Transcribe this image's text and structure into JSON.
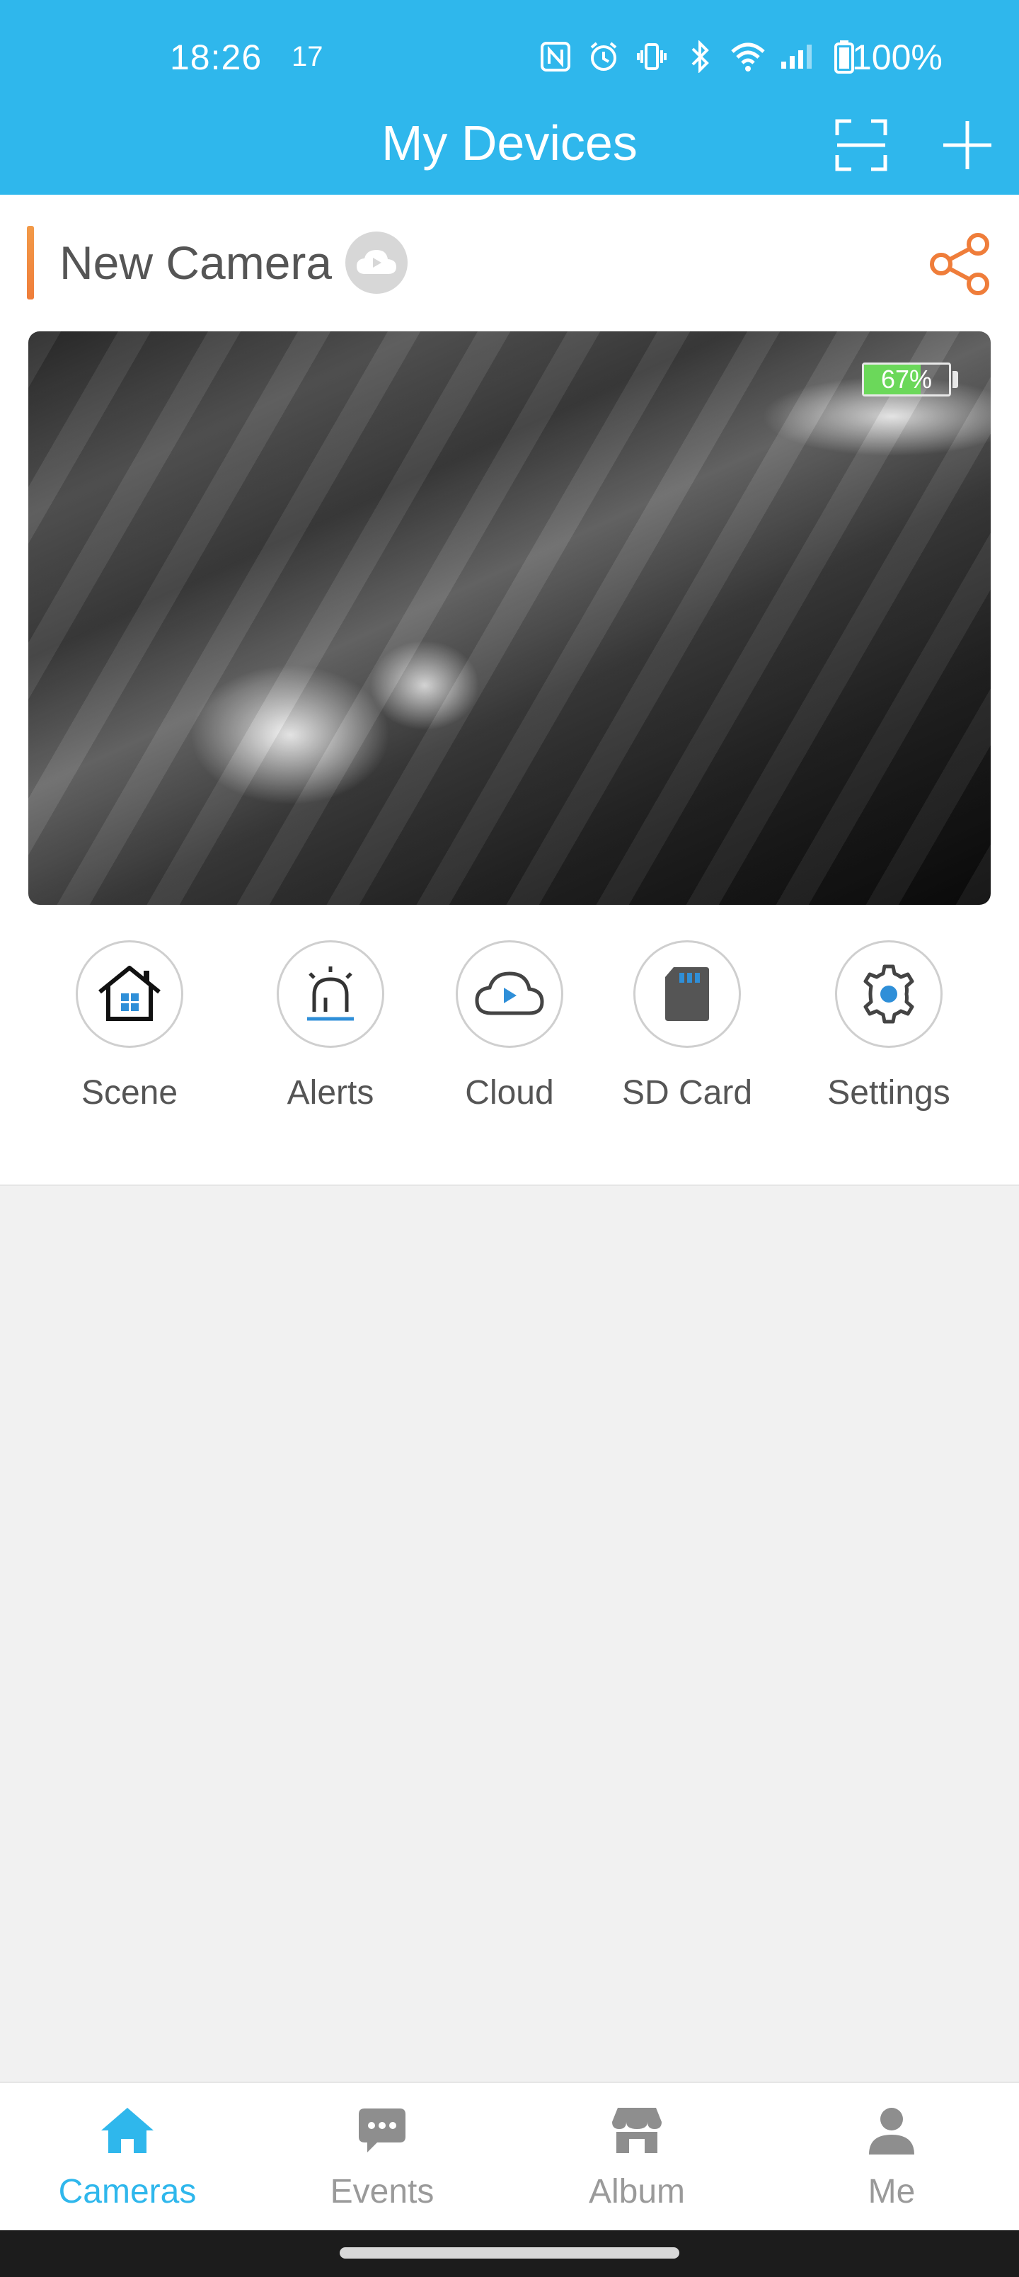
{
  "status_bar": {
    "time": "18:26",
    "notification": "17",
    "battery": "100%"
  },
  "header": {
    "title": "My Devices",
    "scan_icon": "scan-frame-icon",
    "add_icon": "plus-icon"
  },
  "device": {
    "name": "New Camera",
    "cloud_badge_icon": "cloud-icon",
    "share_icon": "share-icon",
    "battery_level": 0.67,
    "battery_text": "67%"
  },
  "actions": [
    {
      "label": "Scene",
      "icon": "home-icon"
    },
    {
      "label": "Alerts",
      "icon": "siren-icon"
    },
    {
      "label": "Cloud",
      "icon": "cloud-play-icon"
    },
    {
      "label": "SD Card",
      "icon": "sd-card-icon"
    },
    {
      "label": "Settings",
      "icon": "gear-icon"
    }
  ],
  "bottom_nav": [
    {
      "label": "Cameras",
      "icon": "home-icon",
      "active": true
    },
    {
      "label": "Events",
      "icon": "chat-bubble-icon",
      "active": false
    },
    {
      "label": "Album",
      "icon": "store-icon",
      "active": false
    },
    {
      "label": "Me",
      "icon": "person-icon",
      "active": false
    }
  ],
  "colors": {
    "primary": "#2fb7ec",
    "accent_orange": "#ef7d3a",
    "battery_green": "#6bd85a",
    "inactive_gray": "#9a9a9a"
  }
}
